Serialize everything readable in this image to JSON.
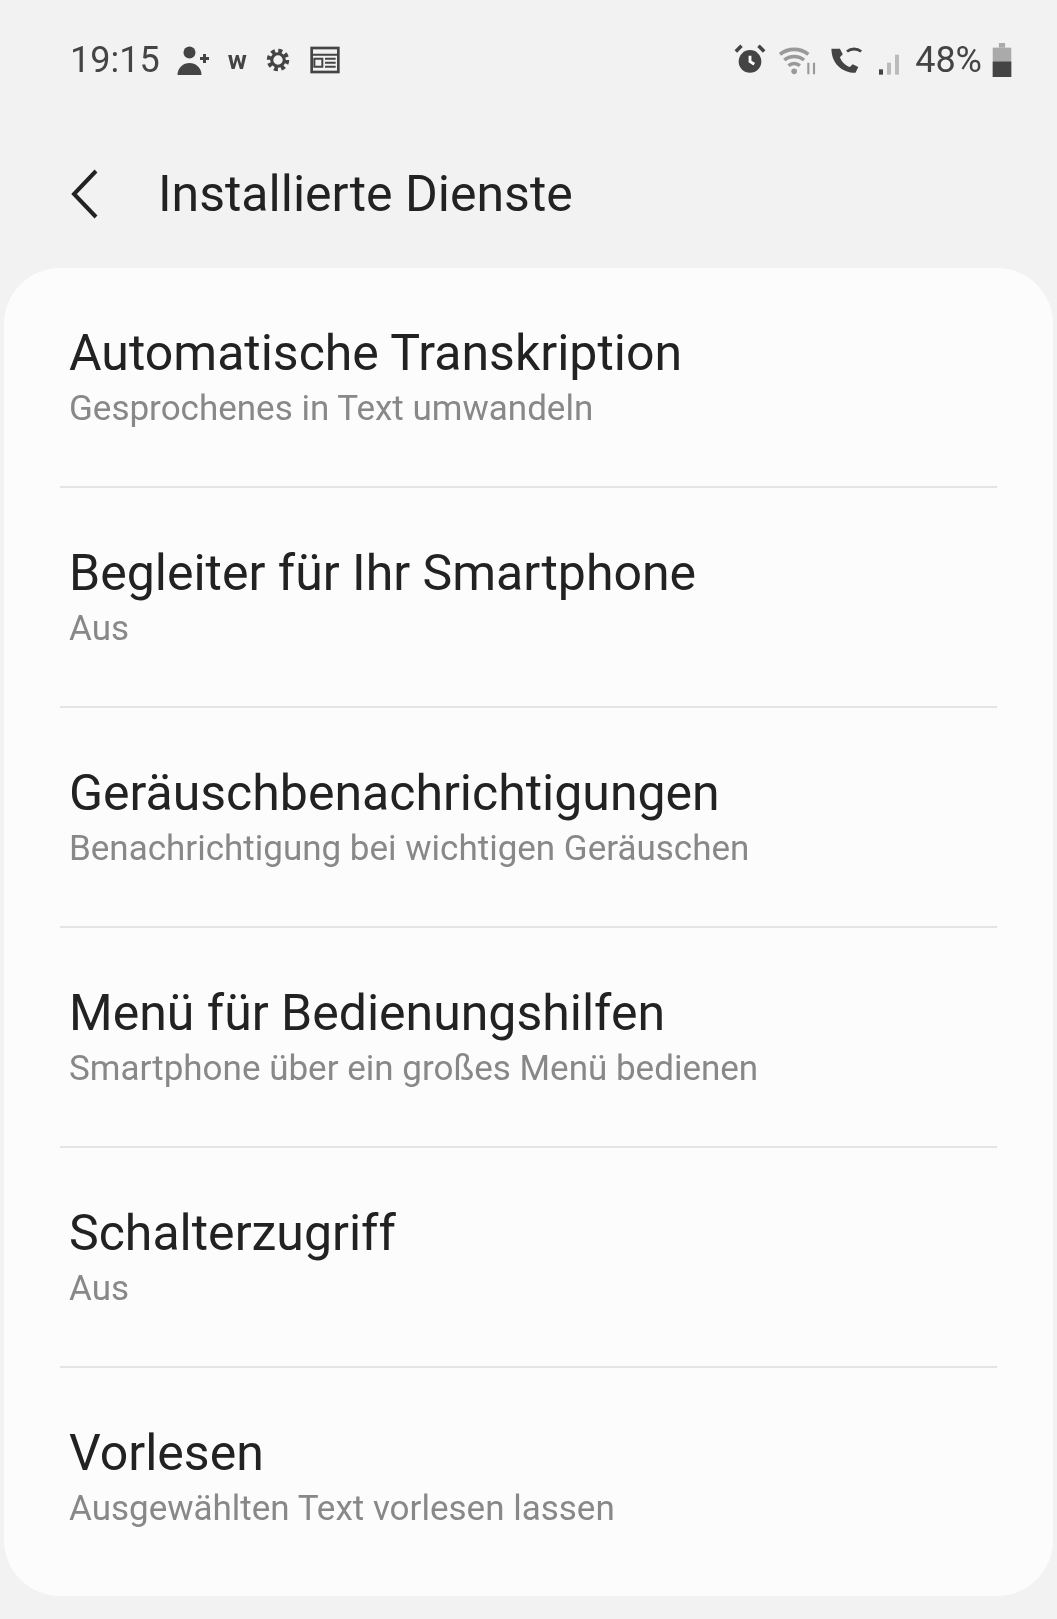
{
  "status_bar": {
    "time": "19:15",
    "notification_letter": "w",
    "battery": "48%"
  },
  "header": {
    "title": "Installierte Dienste"
  },
  "items": [
    {
      "title": "Automatische Transkription",
      "subtitle": "Gesprochenes in Text umwandeln"
    },
    {
      "title": "Begleiter für Ihr Smartphone",
      "subtitle": "Aus"
    },
    {
      "title": "Geräuschbenachrichtigungen",
      "subtitle": "Benachrichtigung bei wichtigen Geräuschen"
    },
    {
      "title": "Menü für Bedienungshilfen",
      "subtitle": "Smartphone über ein großes Menü bedienen"
    },
    {
      "title": "Schalterzugriff",
      "subtitle": "Aus"
    },
    {
      "title": "Vorlesen",
      "subtitle": "Ausgewählten Text vorlesen lassen"
    }
  ]
}
